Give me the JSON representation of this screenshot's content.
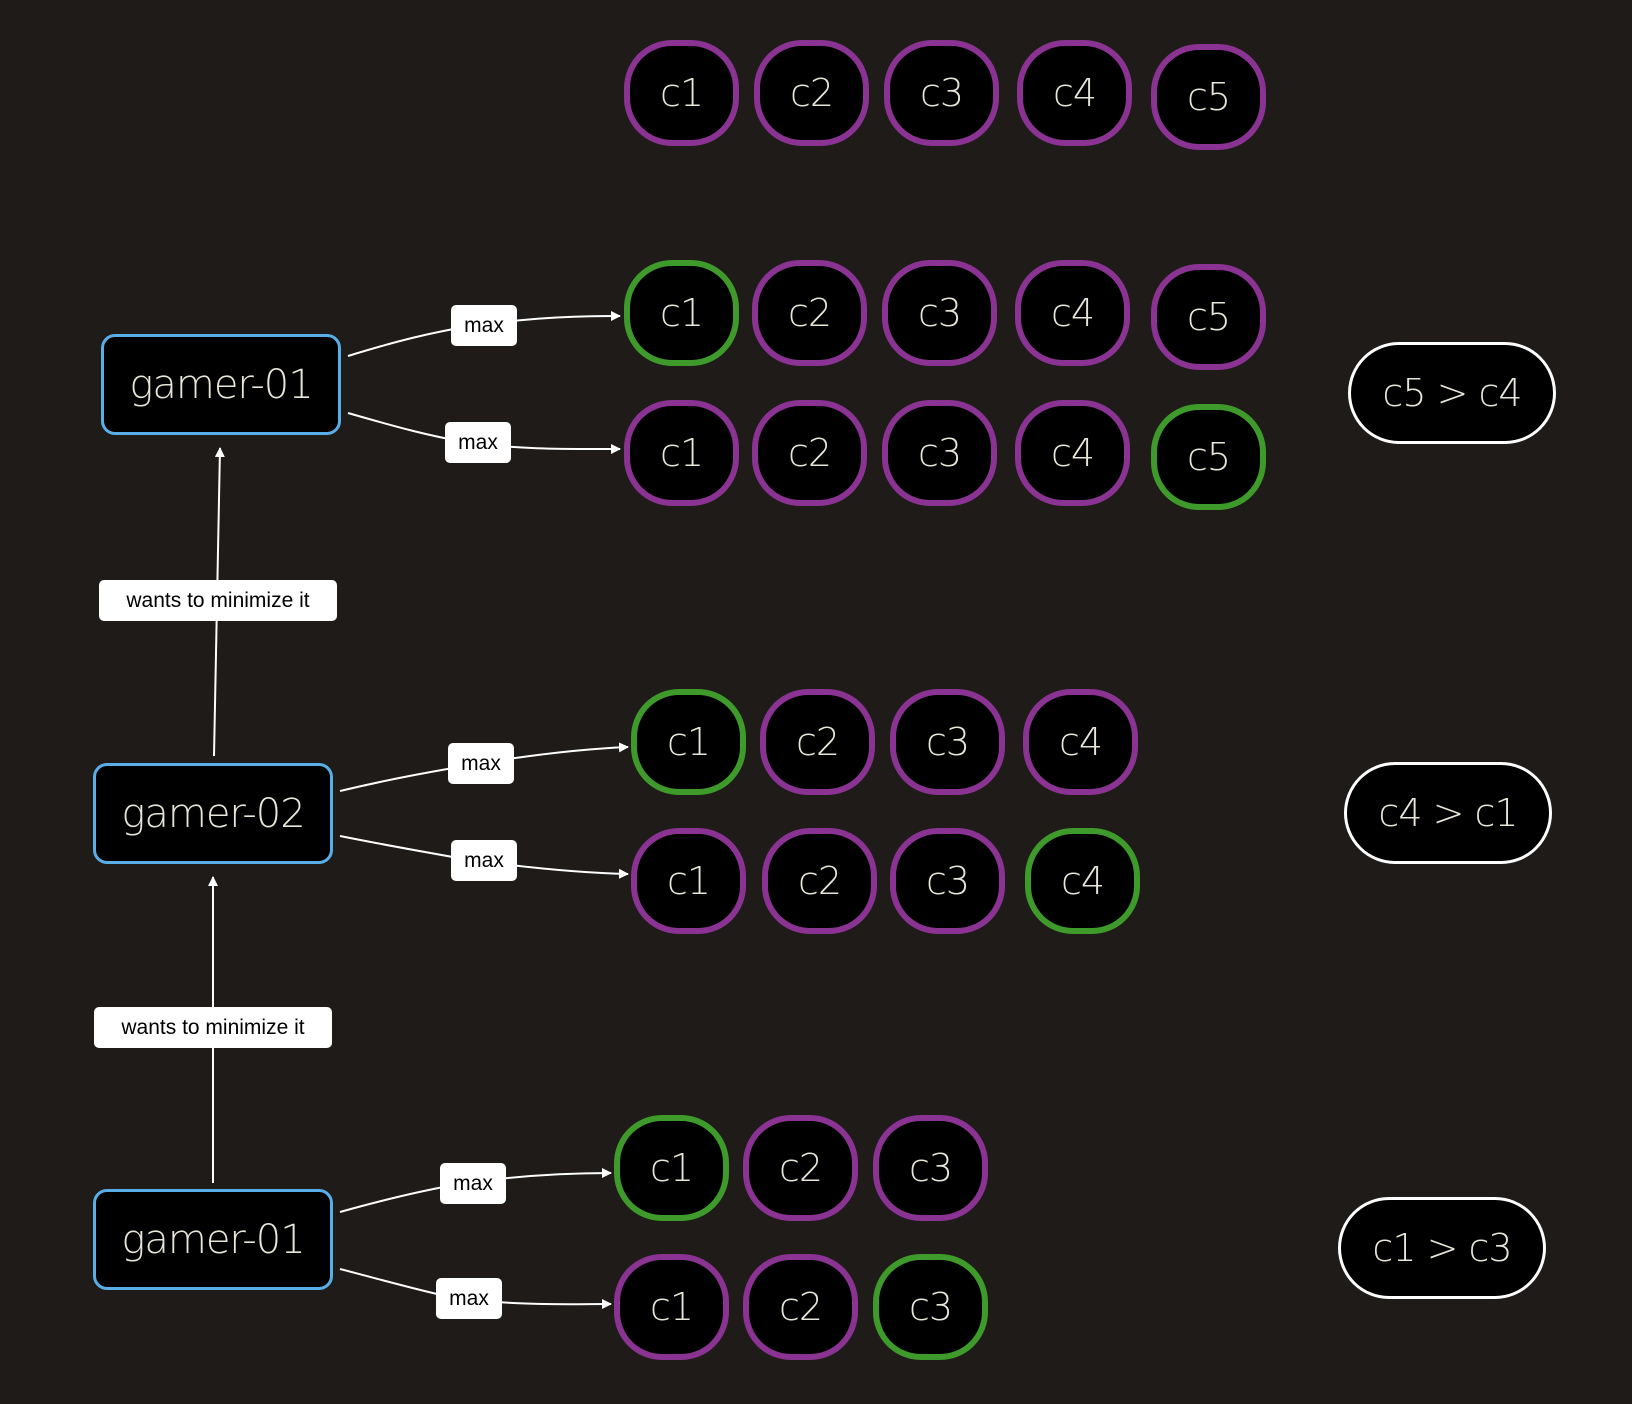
{
  "diagram": {
    "colors": {
      "background": "#1e1b19",
      "card_default_border": "#8b3393",
      "card_selected_border": "#3e9a2a",
      "player_border": "#5aaee8",
      "result_border": "#ffffff",
      "text": "#e8e6d8"
    },
    "top_row": {
      "cards": [
        "c1",
        "c2",
        "c3",
        "c4",
        "c5"
      ]
    },
    "levels": [
      {
        "player": "gamer-01",
        "rows": [
          {
            "edge_label": "max",
            "cards": [
              "c1",
              "c2",
              "c3",
              "c4",
              "c5"
            ],
            "selected": "c1"
          },
          {
            "edge_label": "max",
            "cards": [
              "c1",
              "c2",
              "c3",
              "c4",
              "c5"
            ],
            "selected": "c5"
          }
        ],
        "result": "c5 > c4"
      },
      {
        "player": "gamer-02",
        "rows": [
          {
            "edge_label": "max",
            "cards": [
              "c1",
              "c2",
              "c3",
              "c4"
            ],
            "selected": "c1"
          },
          {
            "edge_label": "max",
            "cards": [
              "c1",
              "c2",
              "c3",
              "c4"
            ],
            "selected": "c4"
          }
        ],
        "result": "c4 > c1"
      },
      {
        "player": "gamer-01",
        "rows": [
          {
            "edge_label": "max",
            "cards": [
              "c1",
              "c2",
              "c3"
            ],
            "selected": "c1"
          },
          {
            "edge_label": "max",
            "cards": [
              "c1",
              "c2",
              "c3"
            ],
            "selected": "c3"
          }
        ],
        "result": "c1 > c3"
      }
    ],
    "connectors": [
      {
        "from": "gamer-02",
        "to": "gamer-01 (top)",
        "label": "wants to minimize it"
      },
      {
        "from": "gamer-01 (bottom)",
        "to": "gamer-02",
        "label": "wants to minimize it"
      }
    ]
  }
}
